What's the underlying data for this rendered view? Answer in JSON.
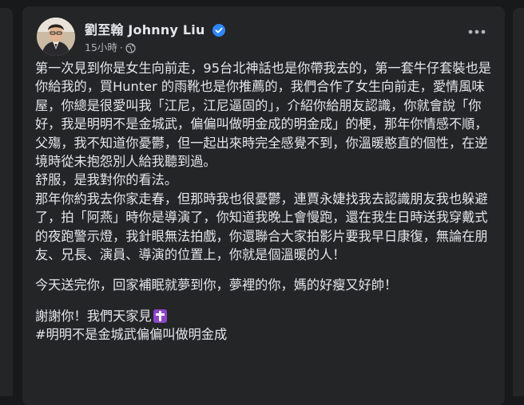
{
  "post": {
    "author": "劉至翰 Johnny Liu",
    "timestamp": "15小時",
    "separator": "·",
    "paragraph1": "第一次見到你是女生向前走，95台北神話也是你帶我去的，第一套牛仔套裝也是你給我的，買Hunter 的雨靴也是你推薦的，我們合作了女生向前走，愛情風味屋，你總是很愛叫我「江尼，江尼逼固的」，介紹你給朋友認識，你就會說「你好，我是明明不是金城武，偏偏叫做明金成的明金成」的梗，那年你情感不順，父殤，我不知道你憂鬱，但一起出來時完全感覺不到，你溫暖憨直的個性，在逆境時從未抱怨別人給我聽到過。",
    "paragraph2": "舒服，是我對你的看法。",
    "paragraph3": "那年你約我去你家走春，但那時我也很憂鬱，連賈永婕找我去認識朋友我也躲避了，拍「阿燕」時你是導演了，你知道我晚上會慢跑，還在我生日時送我穿戴式的夜跑警示燈，我針眼無法拍戲，你還聯合大家拍影片要我早日康復，無論在朋友、兄長、演員、導演的位置上，你就是個溫暖的人！",
    "paragraph4": "今天送完你，回家補眠就夢到你，夢裡的你，媽的好瘦又好帥！",
    "paragraph5": "謝謝你！我們天家見",
    "hashtag": "#明明不是金城武偏偏叫做明金成"
  },
  "icons": {
    "verified": "verified-badge-icon",
    "audience": "globe-icon",
    "more": "more-options-icon",
    "cross": "latin-cross-emoji-icon"
  },
  "colors": {
    "background": "#18191a",
    "card": "#242526",
    "text": "#e4e6eb",
    "secondary_text": "#b0b3b8",
    "verified_blue": "#2d88ff",
    "cross_purple": "#8e44c9"
  }
}
